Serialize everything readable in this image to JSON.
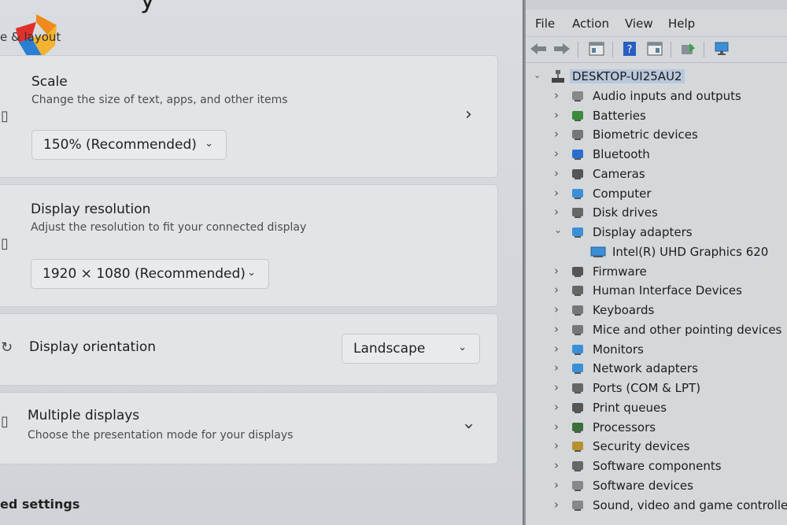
{
  "settings": {
    "title_fragment": "y",
    "breadcrumb": "e & layout",
    "scale": {
      "heading": "Scale",
      "description": "Change the size of text, apps, and other items",
      "value": "150% (Recommended)"
    },
    "resolution": {
      "heading": "Display resolution",
      "description": "Adjust the resolution to fit your connected display",
      "value": "1920 × 1080 (Recommended)"
    },
    "orientation": {
      "heading": "Display orientation",
      "value": "Landscape"
    },
    "multiple": {
      "heading": "Multiple displays",
      "description": "Choose the presentation mode for your displays"
    },
    "section_title": "ed settings"
  },
  "device_manager": {
    "menu": [
      "File",
      "Action",
      "View",
      "Help"
    ],
    "root": "DESKTOP-UI25AU2",
    "categories": [
      {
        "label": "Audio inputs and outputs",
        "icon": "speaker-icon",
        "expanded": false
      },
      {
        "label": "Batteries",
        "icon": "battery-icon",
        "expanded": false
      },
      {
        "label": "Biometric devices",
        "icon": "fingerprint-icon",
        "expanded": false
      },
      {
        "label": "Bluetooth",
        "icon": "bluetooth-icon",
        "expanded": false
      },
      {
        "label": "Cameras",
        "icon": "camera-icon",
        "expanded": false
      },
      {
        "label": "Computer",
        "icon": "monitor-icon",
        "expanded": false
      },
      {
        "label": "Disk drives",
        "icon": "disk-icon",
        "expanded": false
      },
      {
        "label": "Display adapters",
        "icon": "display-adapter-icon",
        "expanded": true,
        "children": [
          {
            "label": "Intel(R) UHD Graphics 620",
            "icon": "display-adapter-icon"
          }
        ]
      },
      {
        "label": "Firmware",
        "icon": "chip-icon",
        "expanded": false
      },
      {
        "label": "Human Interface Devices",
        "icon": "hid-icon",
        "expanded": false
      },
      {
        "label": "Keyboards",
        "icon": "keyboard-icon",
        "expanded": false
      },
      {
        "label": "Mice and other pointing devices",
        "icon": "mouse-icon",
        "expanded": false
      },
      {
        "label": "Monitors",
        "icon": "monitor-icon",
        "expanded": false
      },
      {
        "label": "Network adapters",
        "icon": "network-icon",
        "expanded": false
      },
      {
        "label": "Ports (COM & LPT)",
        "icon": "port-icon",
        "expanded": false
      },
      {
        "label": "Print queues",
        "icon": "printer-icon",
        "expanded": false
      },
      {
        "label": "Processors",
        "icon": "processor-icon",
        "expanded": false
      },
      {
        "label": "Security devices",
        "icon": "security-icon",
        "expanded": false
      },
      {
        "label": "Software components",
        "icon": "component-icon",
        "expanded": false
      },
      {
        "label": "Software devices",
        "icon": "software-device-icon",
        "expanded": false
      },
      {
        "label": "Sound, video and game controllers",
        "icon": "sound-icon",
        "expanded": false
      }
    ]
  }
}
